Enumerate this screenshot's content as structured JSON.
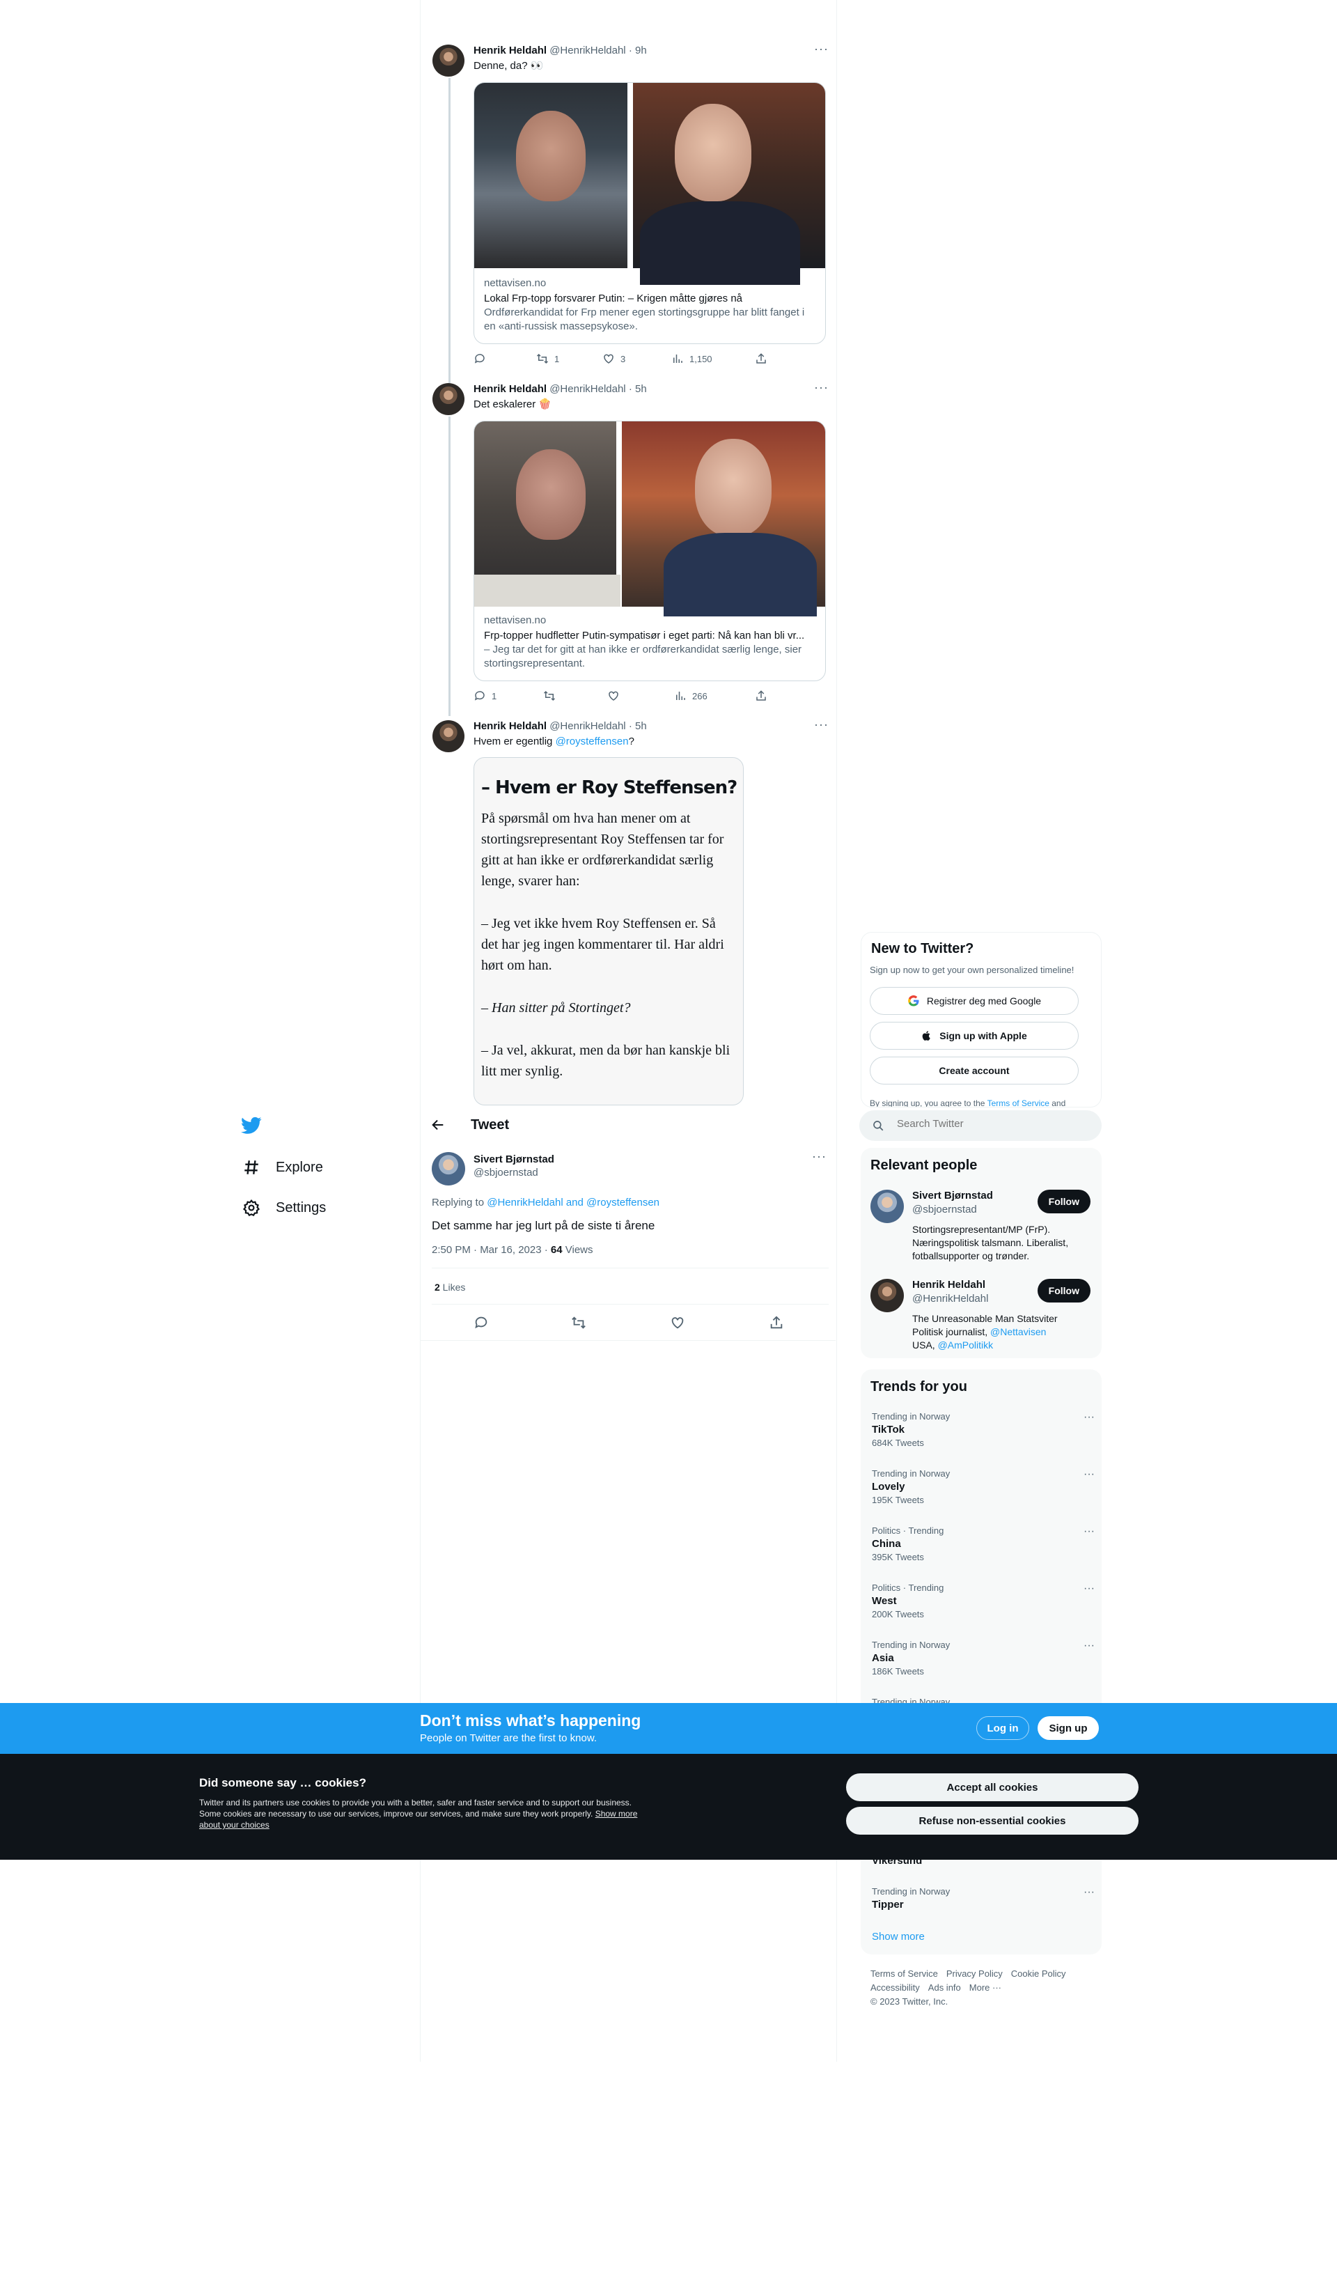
{
  "thread": [
    {
      "name": "Henrik Heldahl",
      "handle": "@HenrikHeldahl",
      "time": "· 9h",
      "text": "Denne, da? 👀",
      "card": {
        "domain": "nettavisen.no",
        "title": "Lokal Frp-topp forsvarer Putin: – Krigen måtte gjøres nå",
        "desc": "Ordførerkandidat for Frp mener egen stortingsgruppe har blitt fanget i en «anti-russisk massepsykose»."
      },
      "stats": {
        "replies": "",
        "retweets": "1",
        "likes": "3",
        "views": "1,150"
      }
    },
    {
      "name": "Henrik Heldahl",
      "handle": "@HenrikHeldahl",
      "time": "· 5h",
      "text": "Det eskalerer 🍿",
      "card": {
        "domain": "nettavisen.no",
        "title": "Frp-topper hudfletter Putin-sympatisør i eget parti: Nå kan han bli vr...",
        "desc": "– Jeg tar det for gitt at han ikke er ordførerkandidat særlig lenge, sier stortingsrepresentant."
      },
      "stats": {
        "replies": "1",
        "retweets": "",
        "likes": "",
        "views": "266"
      }
    },
    {
      "name": "Henrik Heldahl",
      "handle": "@HenrikHeldahl",
      "time": "· 5h",
      "text_before": "Hvem er egentlig ",
      "mention": "@roysteffensen",
      "text_after": "?",
      "article": {
        "headline": "– Hvem er Roy Steffensen?",
        "p1": "På spørsmål om hva han mener om at stortingsrepresentant Roy Steffensen tar for gitt at han ikke er ordførerkandidat særlig lenge, svarer han:",
        "p2": "– Jeg vet ikke hvem Roy Steffensen er. Så det har jeg ingen kommentarer til. Har aldri hørt om han.",
        "p3": "– Han sitter på Stortinget?",
        "p4": "– Ja vel, akkurat, men da bør han kanskje bli litt mer synlig."
      }
    }
  ],
  "nav": {
    "explore": "Explore",
    "settings": "Settings"
  },
  "header": {
    "title": "Tweet"
  },
  "main_tweet": {
    "name": "Sivert Bjørnstad",
    "handle": "@sbjoernstad",
    "replying_prefix": "Replying to ",
    "replying_to": "@HenrikHeldahl and @roysteffensen",
    "text": "Det samme har jeg lurt på de siste ti årene",
    "timestamp": "2:50 PM · Mar 16, 2023 · ",
    "views_count": "64",
    "views_label": " Views",
    "likes_count": "2",
    "likes_label": " Likes"
  },
  "signup": {
    "title": "New to Twitter?",
    "subtitle": "Sign up now to get your own personalized timeline!",
    "google": "Registrer deg med Google",
    "apple": "Sign up with Apple",
    "create": "Create account",
    "terms_prefix": "By signing up, you agree to the ",
    "terms_link": "Terms of Service",
    "terms_suffix": " and"
  },
  "search": {
    "placeholder": "Search Twitter"
  },
  "relevant": {
    "title": "Relevant people",
    "people": [
      {
        "name": "Sivert Bjørnstad",
        "handle": "@sbjoernstad",
        "bio": "Stortingsrepresentant/MP (FrP). Næringspolitisk talsmann. Liberalist, fotballsupporter og trønder.",
        "follow": "Follow"
      },
      {
        "name": "Henrik Heldahl",
        "handle": "@HenrikHeldahl",
        "bio_1": "The Unreasonable Man  Statsviter",
        "bio_2": "Politisk journalist, ",
        "bio_link1": "@Nettavisen",
        "bio_3": "USA, ",
        "bio_link2": "@AmPolitikk",
        "follow": "Follow"
      }
    ]
  },
  "trends": {
    "title": "Trends for you",
    "items": [
      {
        "meta": "Trending in Norway",
        "name": "TikTok",
        "count": "684K Tweets"
      },
      {
        "meta": "Trending in Norway",
        "name": "Lovely",
        "count": "195K Tweets"
      },
      {
        "meta": "Politics · Trending",
        "name": "China",
        "count": "395K Tweets"
      },
      {
        "meta": "Politics · Trending",
        "name": "West",
        "count": "200K Tweets"
      },
      {
        "meta": "Trending in Norway",
        "name": "Asia",
        "count": "186K Tweets"
      },
      {
        "meta": "Trending in Norway",
        "name": "",
        "count": ""
      },
      {
        "meta": "",
        "name": "Vikersund",
        "count": ""
      },
      {
        "meta": "Trending in Norway",
        "name": "Tipper",
        "count": ""
      }
    ],
    "show_more": "Show more"
  },
  "footer": {
    "links_row1": [
      "Terms of Service",
      "Privacy Policy",
      "Cookie Policy"
    ],
    "links_row2": [
      "Accessibility",
      "Ads info",
      "More ···"
    ],
    "copyright": "© 2023 Twitter, Inc."
  },
  "banner": {
    "title": "Don’t miss what’s happening",
    "subtitle": "People on Twitter are the first to know.",
    "login": "Log in",
    "signup": "Sign up"
  },
  "cookies": {
    "title": "Did someone say … cookies?",
    "text": "Twitter and its partners use cookies to provide you with a better, safer and faster service and to support our business. Some cookies are necessary to use our services, improve our services, and make sure they work properly. ",
    "link": "Show more about your choices",
    "accept": "Accept all cookies",
    "refuse": "Refuse non-essential cookies"
  },
  "colors": {
    "accent": "#1d9bf0",
    "dark": "#0f1419",
    "muted": "#536471"
  }
}
